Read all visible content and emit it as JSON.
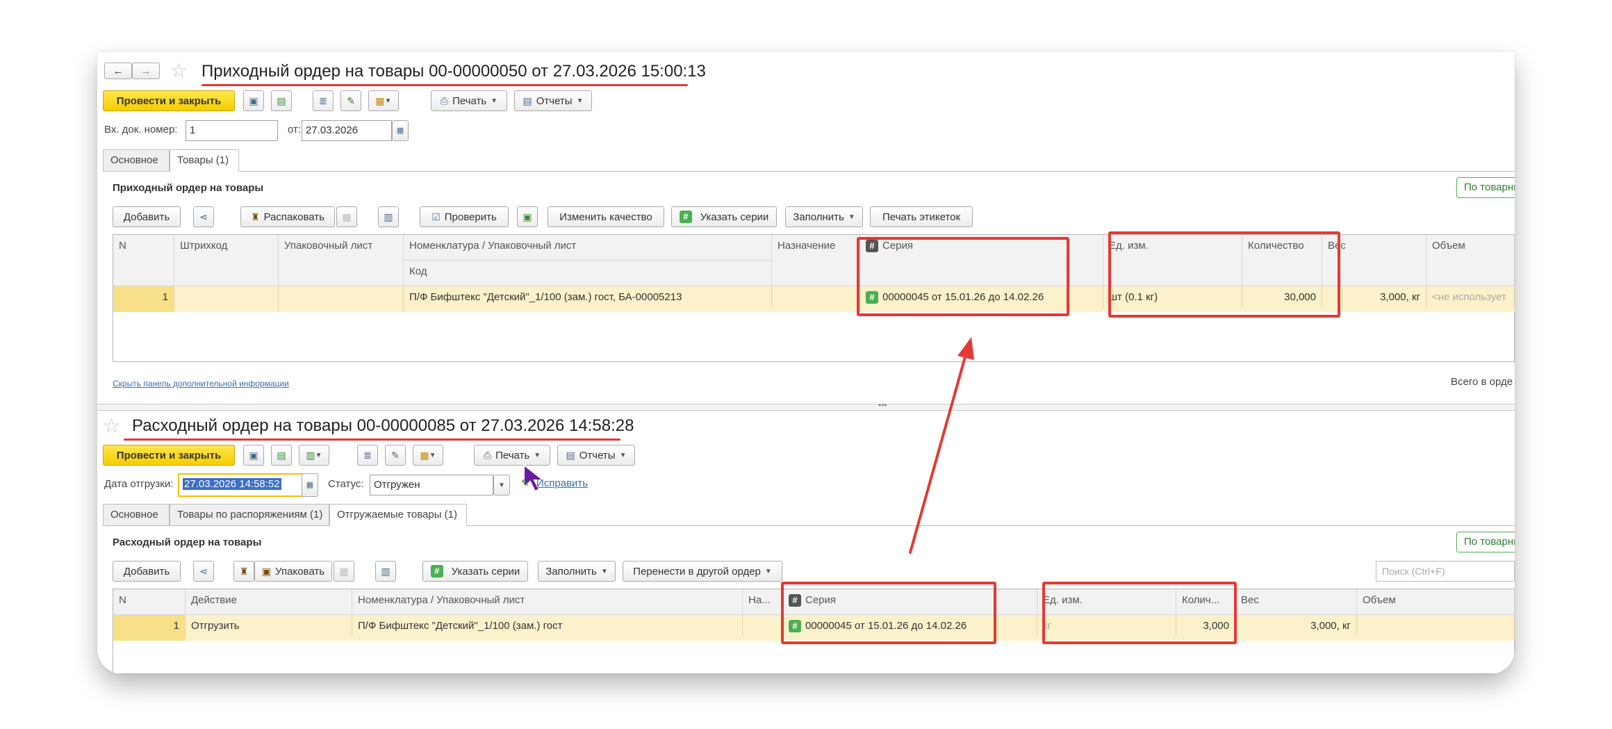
{
  "receipt": {
    "nav_back": "←",
    "nav_forward": "→",
    "title": "Приходный ордер на товары 00-00000050 от 27.03.2026 15:00:13",
    "post_close_label": "Провести и закрыть",
    "print_label": "Печать",
    "reports_label": "Отчеты",
    "doc_number_label": "Вх. док. номер:",
    "doc_number_value": "1",
    "date_from_label": "от:",
    "date_value": "27.03.2026",
    "tabs": [
      "Основное",
      "Товары (1)"
    ],
    "section_title": "Приходный ордер на товары",
    "by_goods_label": "По товарны",
    "toolbar": {
      "add": "Добавить",
      "unpack": "Распаковать",
      "check": "Проверить",
      "change_quality": "Изменить качество",
      "specify_series": "Указать серии",
      "fill": "Заполнить",
      "print_labels": "Печать этикеток"
    },
    "columns": {
      "n": "N",
      "barcode": "Штрихкод",
      "packing_list": "Упаковочный лист",
      "nomenclature": "Номенклатура / Упаковочный лист",
      "code": "Код",
      "purpose": "Назначение",
      "series": "Серия",
      "unit": "Ед. изм.",
      "quantity": "Количество",
      "weight": "Вес",
      "volume": "Объем"
    },
    "row": {
      "n": "1",
      "nomenclature": "П/Ф Бифштекс \"Детский\"_1/100 (зам.) гост, БА-00005213",
      "series": "00000045 от 15.01.26 до 14.02.26",
      "unit": "шт (0.1 кг)",
      "quantity": "30,000",
      "weight": "3,000, кг",
      "volume": "<не использует"
    },
    "hide_panel_link": "Скрыть панель дополнительной информации",
    "total_label": "Всего в орде"
  },
  "expense": {
    "title": "Расходный ордер на товары 00-00000085 от 27.03.2026 14:58:28",
    "post_close_label": "Провести и закрыть",
    "print_label": "Печать",
    "reports_label": "Отчеты",
    "ship_date_label": "Дата отгрузки:",
    "ship_date_value": "27.03.2026 14:58:52",
    "status_label": "Статус:",
    "status_value": "Отгружен",
    "fix_link": "Исправить",
    "tabs": [
      "Основное",
      "Товары по распоряжениям (1)",
      "Отгружаемые товары (1)"
    ],
    "section_title": "Расходный ордер на товары",
    "by_goods_label": "По товарны",
    "search_placeholder": "Поиск (Ctrl+F)",
    "toolbar": {
      "add": "Добавить",
      "pack": "Упаковать",
      "specify_series": "Указать серии",
      "fill": "Заполнить",
      "move_to_order": "Перенести в другой ордер"
    },
    "columns": {
      "n": "N",
      "action": "Действие",
      "nomenclature": "Номенклатура / Упаковочный лист",
      "na": "На...",
      "series": "Серия",
      "unit": "Ед. изм.",
      "quantity": "Колич...",
      "weight": "Вес",
      "volume": "Объем"
    },
    "row": {
      "n": "1",
      "action": "Отгрузить",
      "nomenclature": "П/Ф Бифштекс \"Детский\"_1/100 (зам.) гост",
      "series": "00000045 от 15.01.26 до 14.02.26",
      "unit": "кг",
      "quantity": "3,000",
      "weight": "3,000, кг"
    }
  },
  "annotation_color": "#e53935",
  "accent_yellow": "#f6cd00"
}
